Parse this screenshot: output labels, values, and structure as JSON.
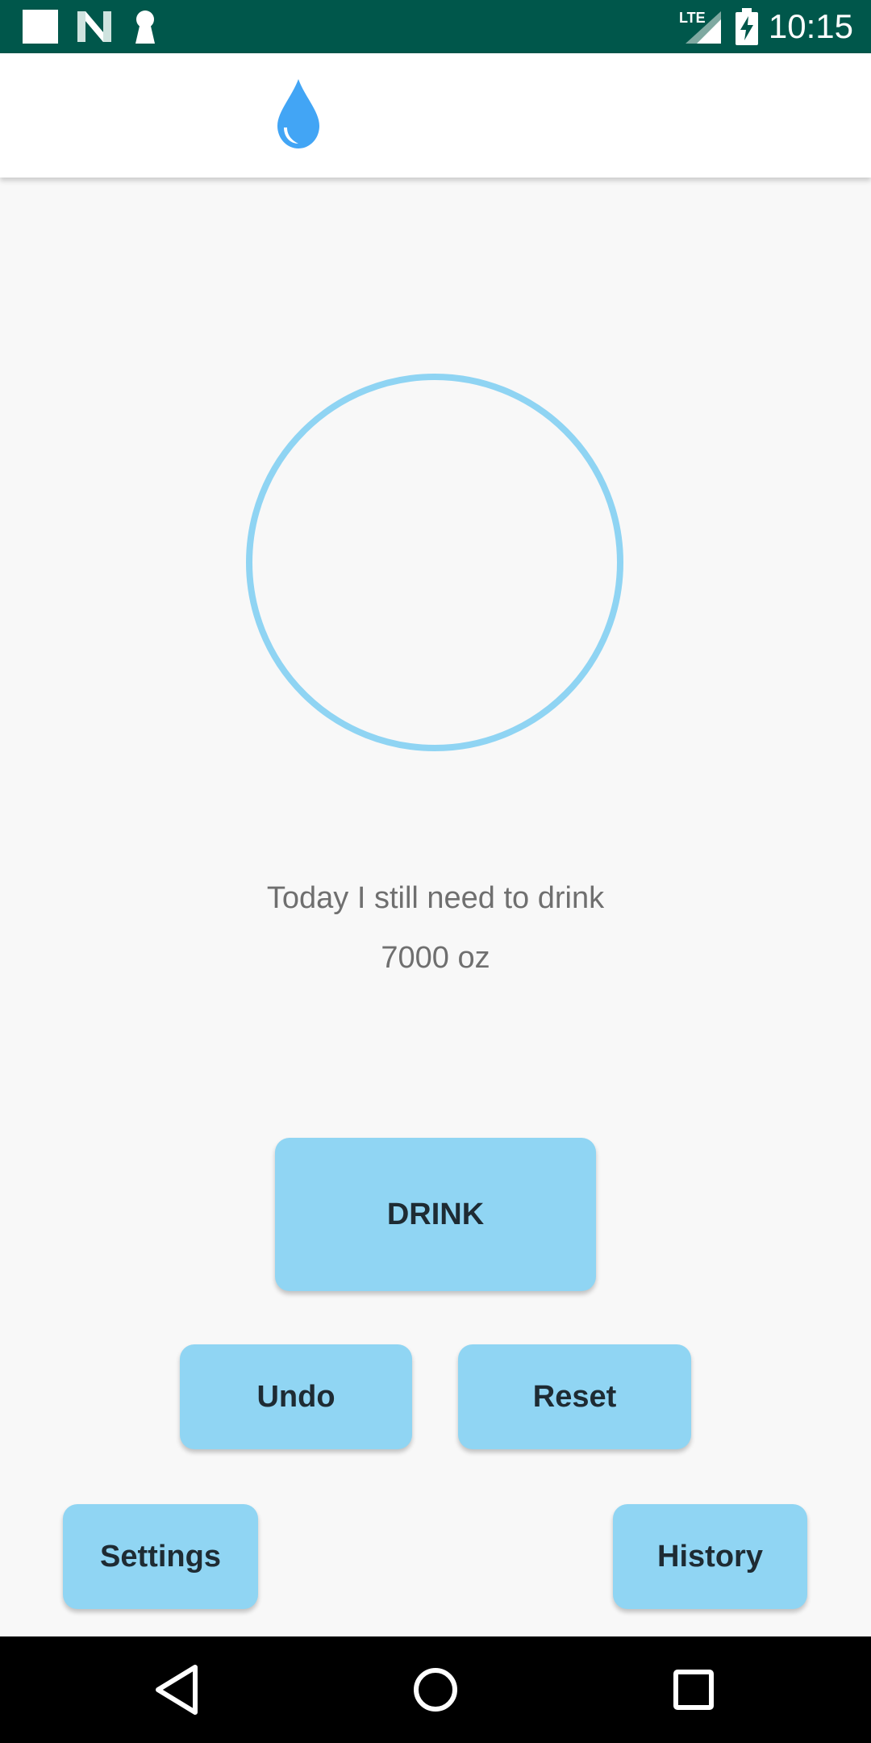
{
  "status_bar": {
    "time": "10:15",
    "network_label": "LTE",
    "icons": [
      "notification-square-icon",
      "n-logo-icon",
      "keyhole-icon",
      "signal-icon",
      "battery-charging-icon"
    ],
    "background_color": "#00574b"
  },
  "app_bar": {
    "logo_icon": "water-drop-icon",
    "logo_color": "#42a5f5"
  },
  "main": {
    "progress": {
      "icon": "progress-ring",
      "ring_color": "#8fd4f3",
      "percent": 0
    },
    "remaining_label": "Today I still need to drink",
    "remaining_amount": "7000 oz"
  },
  "buttons": {
    "drink": "DRINK",
    "undo": "Undo",
    "reset": "Reset",
    "settings": "Settings",
    "history": "History",
    "color": "#90d5f3"
  },
  "nav_bar": {
    "icons": [
      "back-icon",
      "home-icon",
      "recents-icon"
    ]
  }
}
